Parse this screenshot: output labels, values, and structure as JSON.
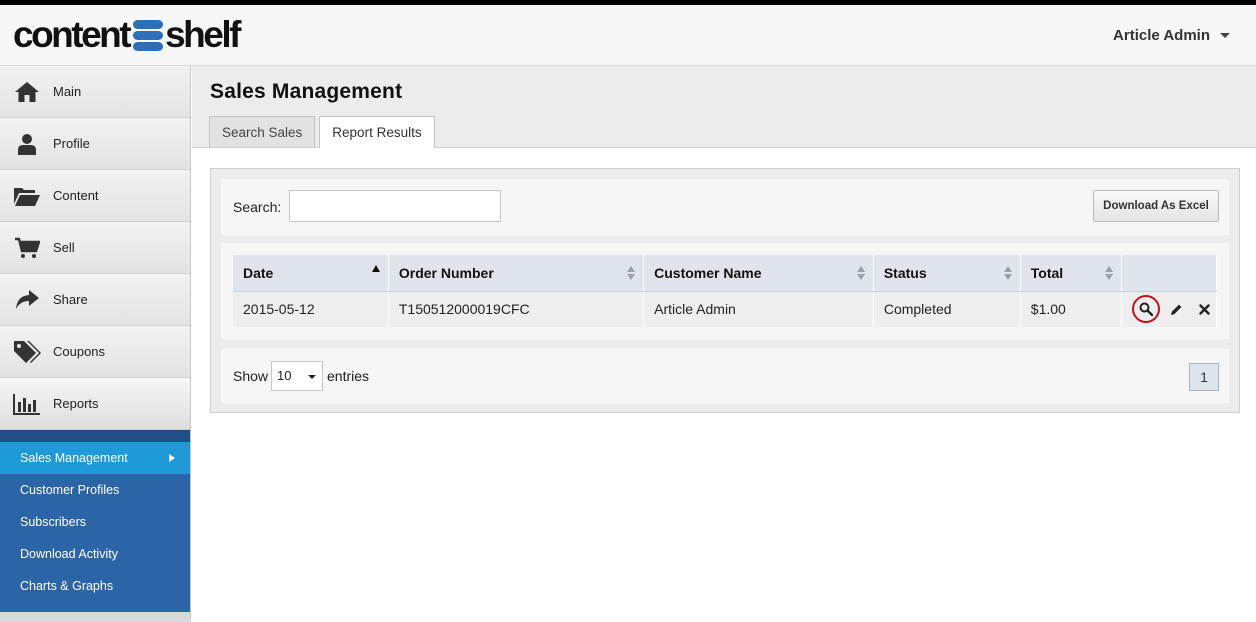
{
  "header": {
    "logo_left": "content",
    "logo_right": "shelf",
    "user_name": "Article Admin"
  },
  "sidebar": {
    "items": [
      {
        "label": "Main",
        "icon": "home-icon"
      },
      {
        "label": "Profile",
        "icon": "user-icon"
      },
      {
        "label": "Content",
        "icon": "folder-open-icon"
      },
      {
        "label": "Sell",
        "icon": "cart-icon"
      },
      {
        "label": "Share",
        "icon": "share-arrow-icon"
      },
      {
        "label": "Coupons",
        "icon": "tags-icon"
      },
      {
        "label": "Reports",
        "icon": "bar-chart-icon"
      }
    ],
    "subitems": [
      {
        "label": "Sales Management",
        "active": true
      },
      {
        "label": "Customer Profiles"
      },
      {
        "label": "Subscribers"
      },
      {
        "label": "Download Activity"
      },
      {
        "label": "Charts & Graphs"
      }
    ]
  },
  "main": {
    "title": "Sales Management",
    "tabs": [
      {
        "label": "Search Sales"
      },
      {
        "label": "Report Results",
        "active": true
      }
    ],
    "search": {
      "label": "Search:",
      "value": ""
    },
    "download_button": "Download As Excel",
    "table": {
      "columns": [
        "Date",
        "Order Number",
        "Customer Name",
        "Status",
        "Total",
        ""
      ],
      "rows": [
        {
          "date": "2015-05-12",
          "order_number": "T150512000019CFC",
          "customer_name": "Article Admin",
          "status": "Completed",
          "total": "$1.00"
        }
      ]
    },
    "length": {
      "show": "Show",
      "value": "10",
      "entries": "entries"
    },
    "pagination": {
      "current_page": "1"
    }
  },
  "colors": {
    "accent_blue": "#2b65a8",
    "active_sub": "#1e9ad9",
    "highlight_ring": "#c1121f"
  }
}
